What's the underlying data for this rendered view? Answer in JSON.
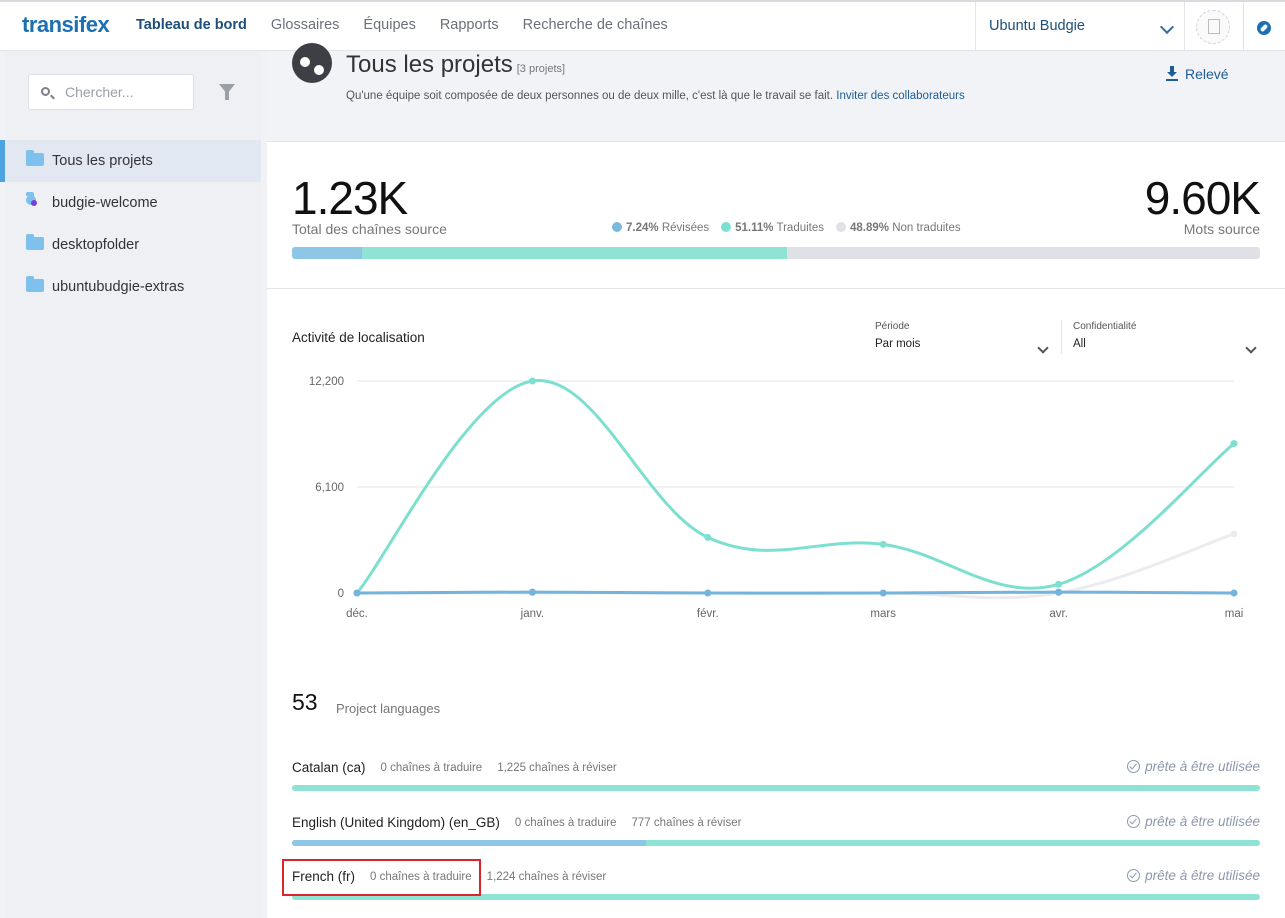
{
  "topbar": {
    "logo": "transifex",
    "nav": [
      "Tableau de bord",
      "Glossaires",
      "Équipes",
      "Rapports",
      "Recherche de chaînes"
    ],
    "org": "Ubuntu Budgie"
  },
  "sidebar": {
    "search_placeholder": "Chercher...",
    "items": [
      {
        "label": "Tous les projets",
        "active": true
      },
      {
        "label": "budgie-welcome"
      },
      {
        "label": "desktopfolder"
      },
      {
        "label": "ubuntubudgie-extras"
      }
    ]
  },
  "header": {
    "title": "Tous les projets",
    "count": "[3 projets]",
    "subtitle": "Qu'une équipe soit composée de deux personnes ou de deux mille, c'est là que le travail se fait.",
    "invite_link": "Inviter des collaborateurs",
    "export": "Relevé"
  },
  "stats": {
    "total_strings": "1.23K",
    "total_strings_label": "Total des chaînes source",
    "words": "9.60K",
    "words_label": "Mots source",
    "reviewed_pct": "7.24%",
    "reviewed_label": "Révisées",
    "translated_pct": "51.11%",
    "translated_label": "Traduites",
    "untranslated_pct": "48.89%",
    "untranslated_label": "Non traduites",
    "reviewed_fraction": 0.0724,
    "translated_fraction": 0.4386
  },
  "activity": {
    "title": "Activité de localisation",
    "period_label": "Période",
    "period_value": "Par mois",
    "privacy_label": "Confidentialité",
    "privacy_value": "All"
  },
  "chart_data": {
    "type": "line",
    "categories": [
      "déc.",
      "janv.",
      "févr.",
      "mars",
      "avr.",
      "mai"
    ],
    "yticks": [
      "12,200",
      "6,100",
      "0"
    ],
    "ylim": [
      0,
      12200
    ],
    "series": [
      {
        "color": "#7ddfcf",
        "values": [
          0,
          12200,
          3200,
          2800,
          500,
          8600
        ]
      },
      {
        "color": "#ececef",
        "values": [
          0,
          0,
          0,
          0,
          0,
          3400
        ]
      },
      {
        "color": "#73b3dc",
        "values": [
          0,
          50,
          0,
          0,
          50,
          0
        ]
      }
    ]
  },
  "languages": {
    "count": "53",
    "count_label": "Project languages",
    "status": "prête à être utilisée",
    "rows": [
      {
        "name": "Catalan (ca)",
        "to_translate": "0 chaînes à traduire",
        "to_review": "1,225 chaînes à réviser",
        "reviewed": 0.0,
        "translated": 1.0
      },
      {
        "name": "English (United Kingdom) (en_GB)",
        "to_translate": "0 chaînes à traduire",
        "to_review": "777 chaînes à réviser",
        "reviewed": 0.366,
        "translated": 0.634
      },
      {
        "name": "French (fr)",
        "to_translate": "0 chaînes à traduire",
        "to_review": "1,224 chaînes à réviser",
        "reviewed": 0.0,
        "translated": 1.0
      }
    ]
  },
  "colors": {
    "accent": "#1b6fb2",
    "reviewed": "#8ec6e6",
    "translated": "#8ee3d5",
    "untranslated": "#dfe1e7"
  }
}
